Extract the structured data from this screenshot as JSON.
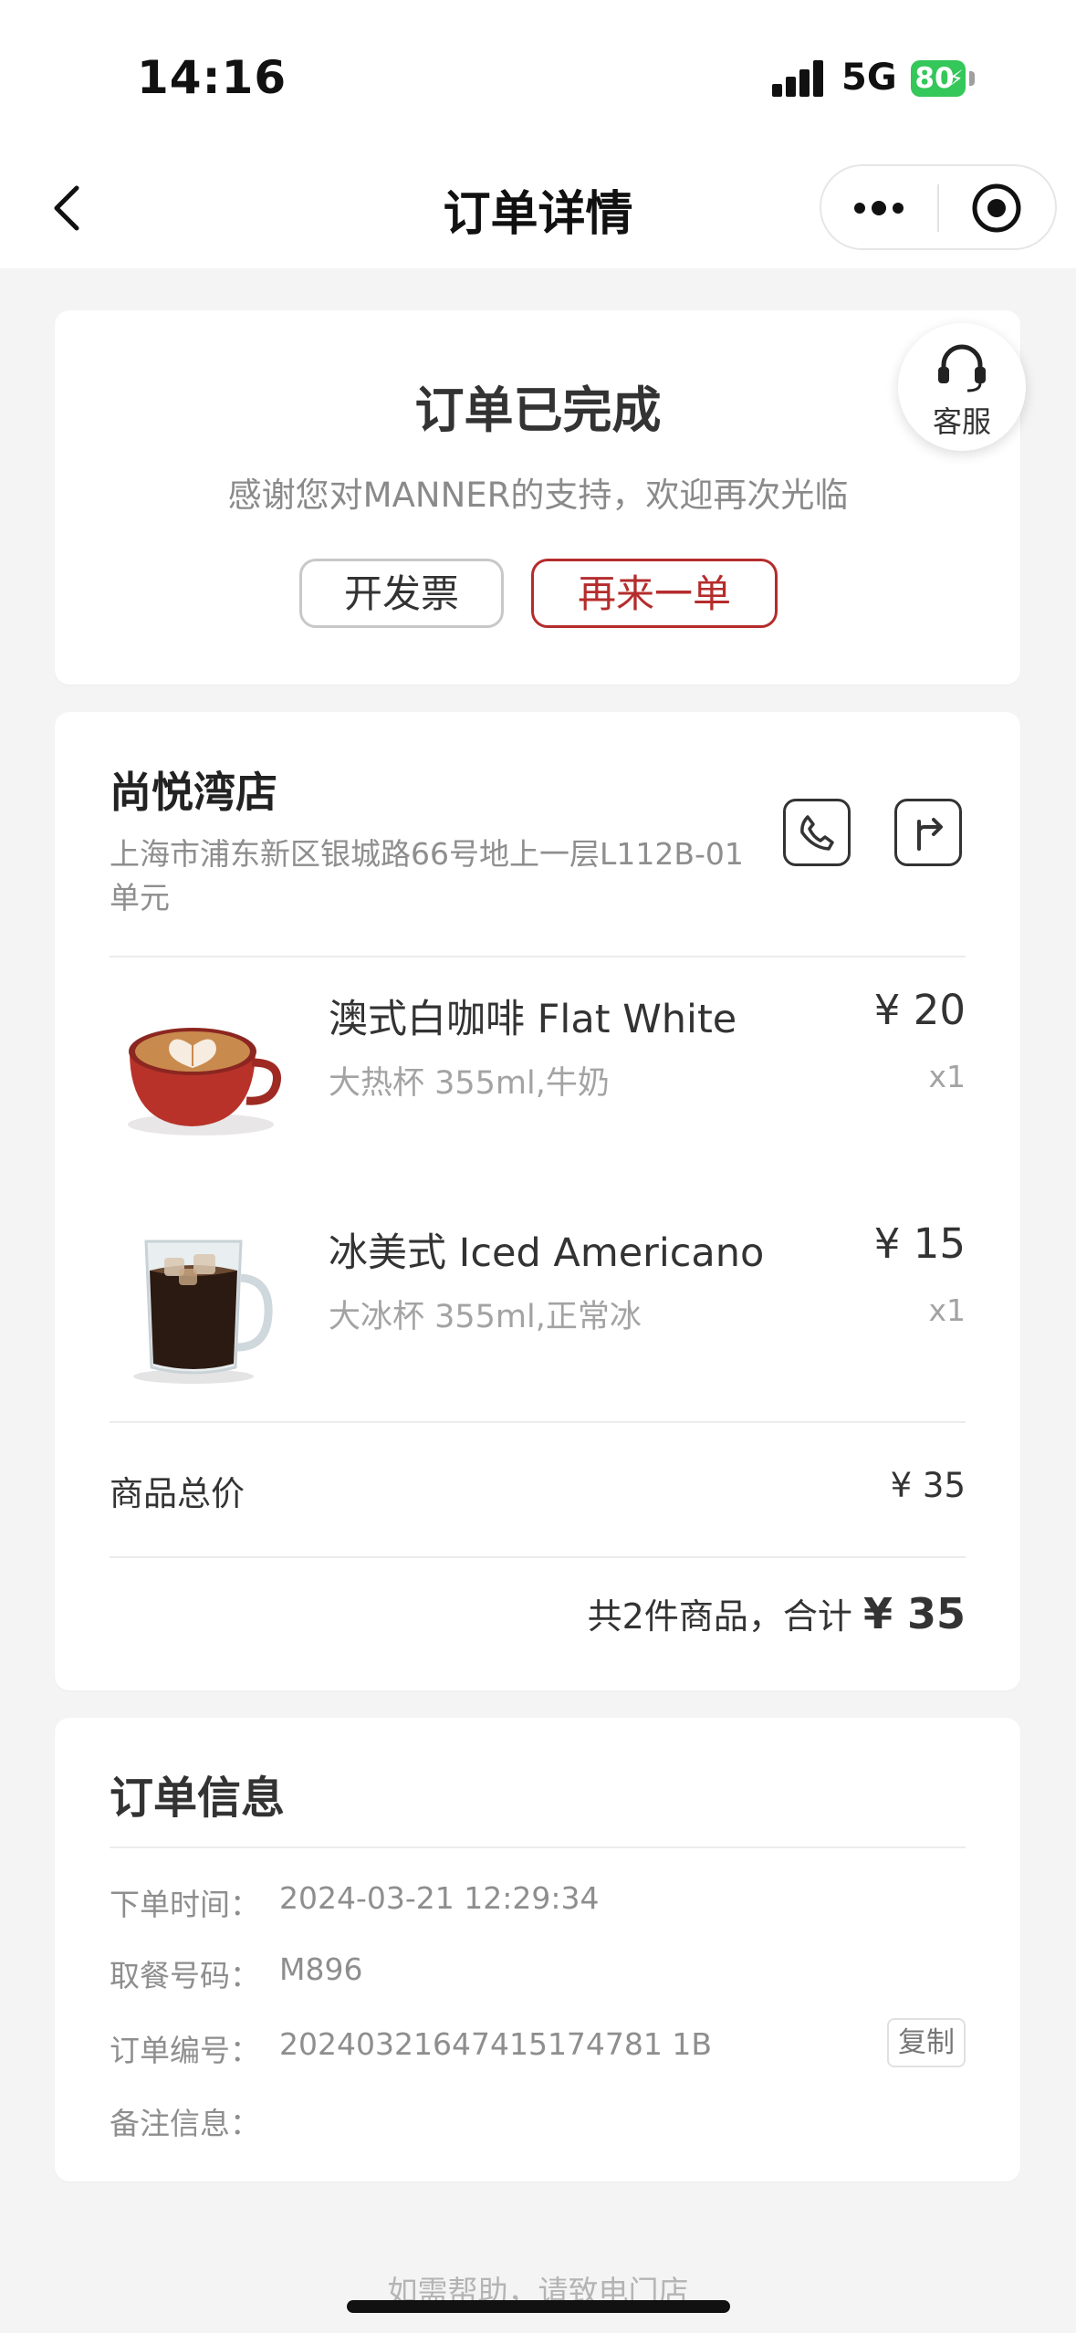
{
  "status_bar": {
    "time": "14:16",
    "network": "5G",
    "battery": "80"
  },
  "nav": {
    "title": "订单详情"
  },
  "order_status": {
    "title": "订单已完成",
    "subtitle": "感谢您对MANNER的支持，欢迎再次光临",
    "invoice_button": "开发票",
    "reorder_button": "再来一单",
    "service_label": "客服"
  },
  "store": {
    "name": "尚悦湾店",
    "address": "上海市浦东新区银城路66号地上一层L112B-01单元"
  },
  "items": [
    {
      "name": "澳式白咖啡 Flat White",
      "spec": "大热杯 355ml,牛奶",
      "price": "¥ 20",
      "qty": "x1"
    },
    {
      "name": "冰美式 Iced Americano",
      "spec": "大冰杯 355ml,正常冰",
      "price": "¥ 15",
      "qty": "x1"
    }
  ],
  "summary": {
    "subtotal_label": "商品总价",
    "subtotal_value": "¥ 35",
    "total_prefix": "共2件商品，合计",
    "total_value": "¥ 35"
  },
  "order_info": {
    "title": "订单信息",
    "fields": [
      {
        "label": "下单时间：",
        "value": "2024-03-21 12:29:34"
      },
      {
        "label": "取餐号码：",
        "value": "M896"
      },
      {
        "label": "订单编号：",
        "value": "20240321647415174781 1B"
      },
      {
        "label": "备注信息：",
        "value": ""
      }
    ],
    "copy_button": "复制"
  },
  "footer": {
    "note": "如需帮助，请致电门店"
  },
  "colors": {
    "accent": "#b52c2c",
    "battery": "#34c759",
    "background": "#f4f4f4"
  }
}
